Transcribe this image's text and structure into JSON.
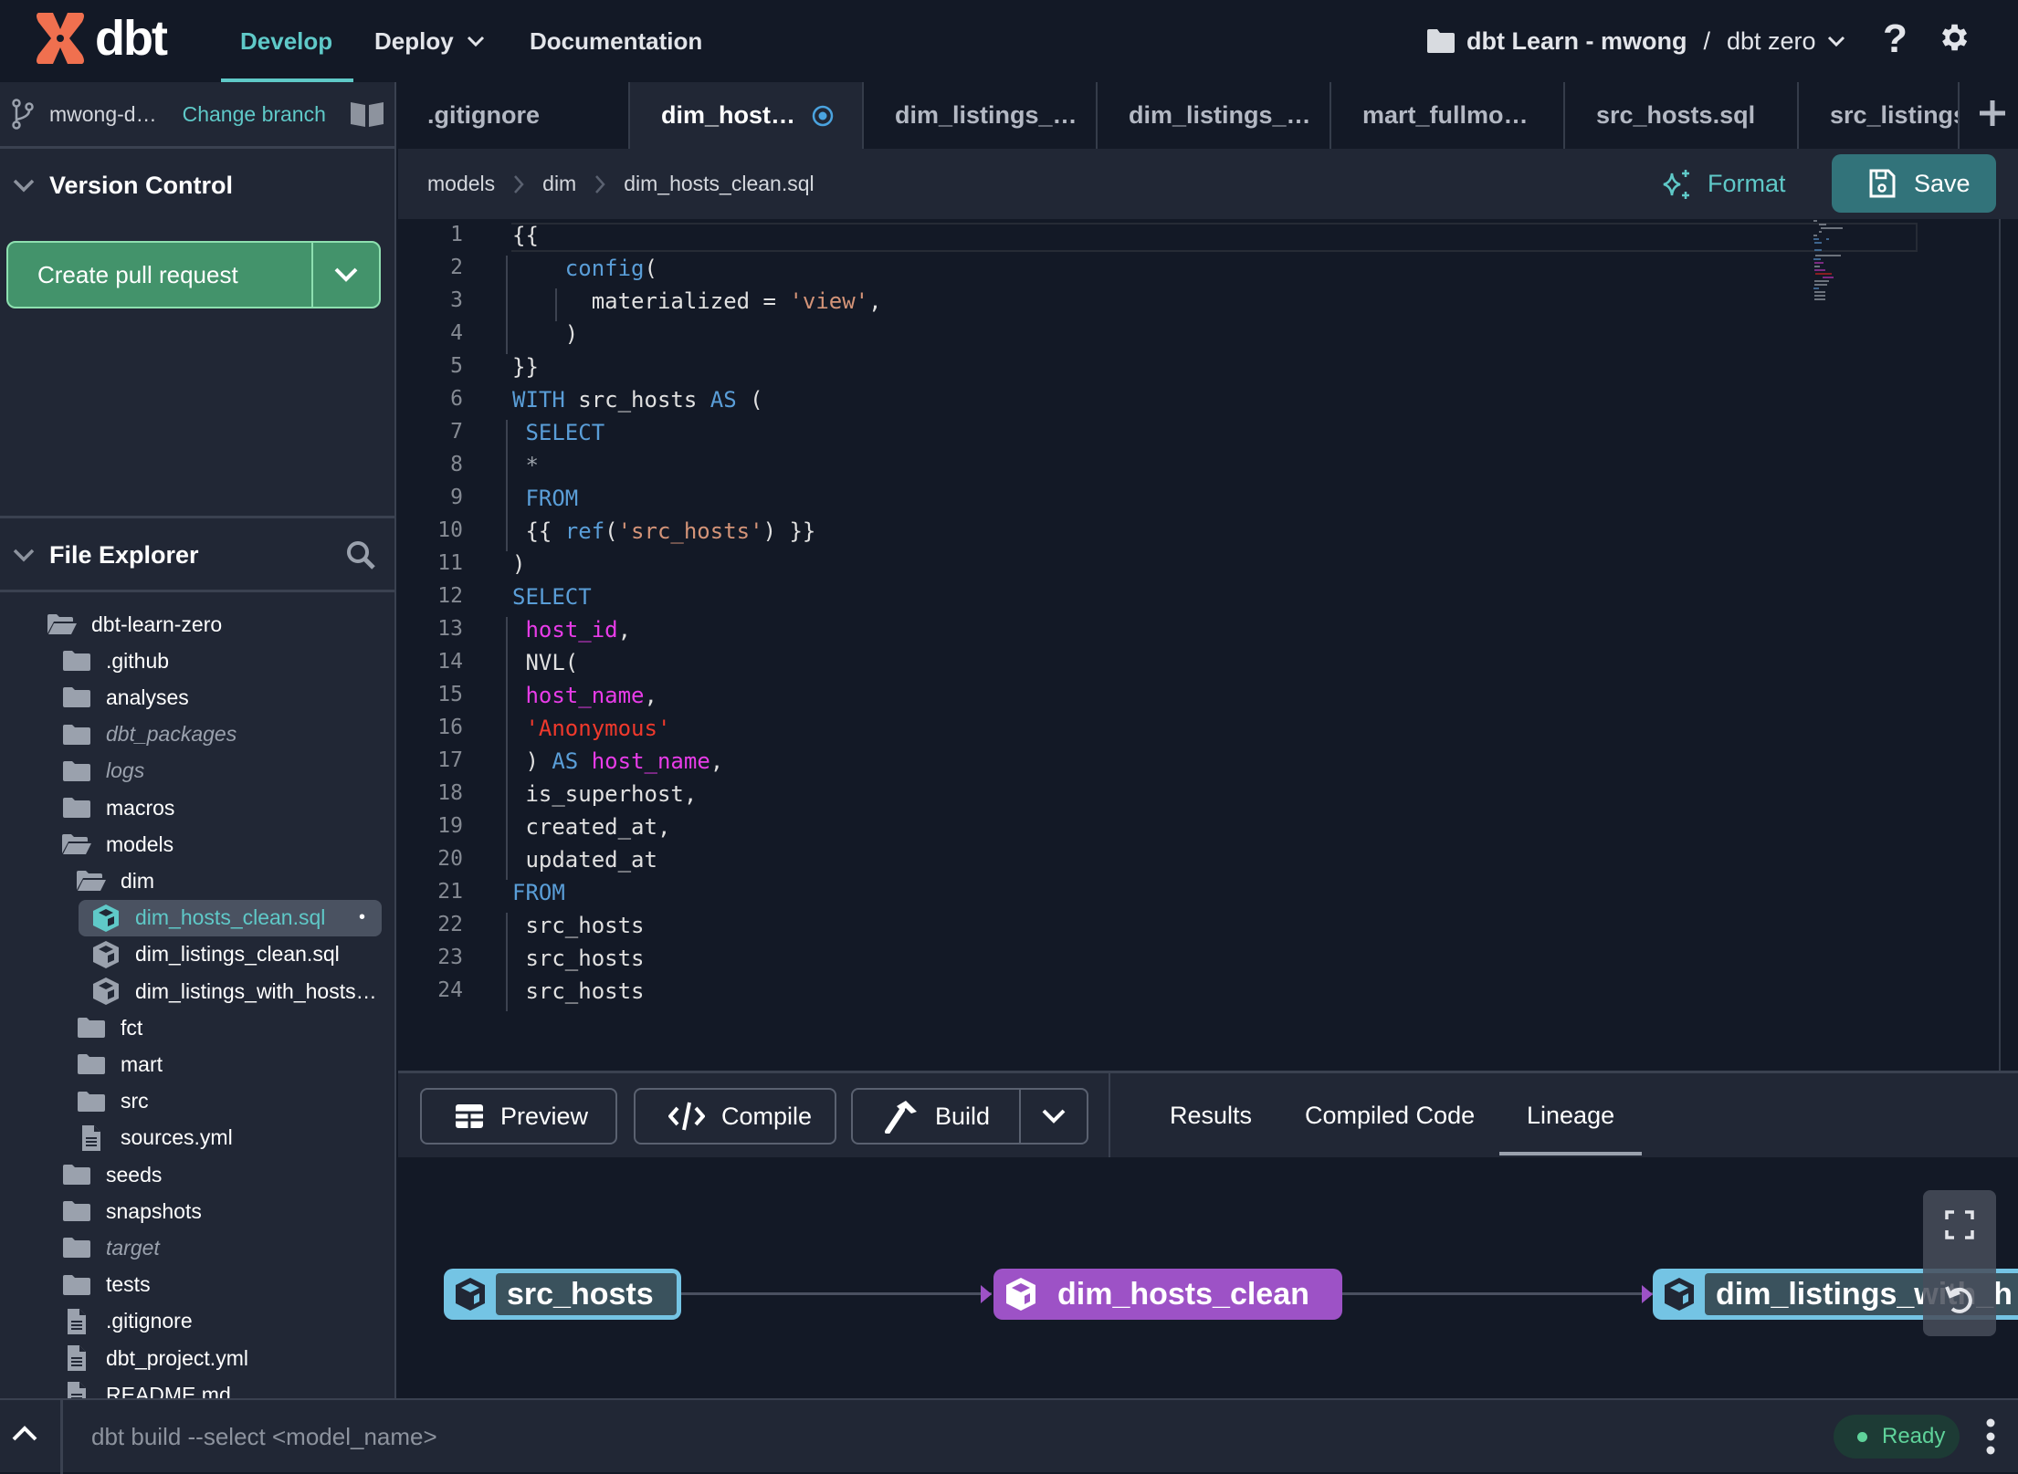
{
  "topbar": {
    "logo_text": "dbt",
    "nav": [
      "Develop",
      "Deploy",
      "Documentation"
    ],
    "account": "dbt Learn - mwong",
    "separator": "/",
    "project": "dbt zero"
  },
  "tabs": [
    ".gitignore",
    "dim_host…",
    "dim_listings_…",
    "dim_listings_…",
    "mart_fullmo…",
    "src_hosts.sql",
    "src_listings."
  ],
  "active_tab": 1,
  "sidebar": {
    "branch": "mwong-d…",
    "change_branch": "Change branch",
    "version_control": "Version Control",
    "create_pr": "Create pull request",
    "file_explorer": "File Explorer",
    "tree": [
      {
        "label": "dbt-learn-zero",
        "depth": 0,
        "icon": "folder-open"
      },
      {
        "label": ".github",
        "depth": 1,
        "icon": "folder"
      },
      {
        "label": "analyses",
        "depth": 1,
        "icon": "folder"
      },
      {
        "label": "dbt_packages",
        "depth": 1,
        "icon": "folder",
        "italic": true
      },
      {
        "label": "logs",
        "depth": 1,
        "icon": "folder",
        "italic": true
      },
      {
        "label": "macros",
        "depth": 1,
        "icon": "folder"
      },
      {
        "label": "models",
        "depth": 1,
        "icon": "folder-open"
      },
      {
        "label": "dim",
        "depth": 2,
        "icon": "folder-open"
      },
      {
        "label": "dim_hosts_clean.sql",
        "depth": 3,
        "icon": "model",
        "selected": true,
        "modified": "•"
      },
      {
        "label": "dim_listings_clean.sql",
        "depth": 3,
        "icon": "model"
      },
      {
        "label": "dim_listings_with_hosts…",
        "depth": 3,
        "icon": "model"
      },
      {
        "label": "fct",
        "depth": 2,
        "icon": "folder"
      },
      {
        "label": "mart",
        "depth": 2,
        "icon": "folder"
      },
      {
        "label": "src",
        "depth": 2,
        "icon": "folder"
      },
      {
        "label": "sources.yml",
        "depth": 2,
        "icon": "file"
      },
      {
        "label": "seeds",
        "depth": 1,
        "icon": "folder"
      },
      {
        "label": "snapshots",
        "depth": 1,
        "icon": "folder"
      },
      {
        "label": "target",
        "depth": 1,
        "icon": "folder",
        "italic": true
      },
      {
        "label": "tests",
        "depth": 1,
        "icon": "folder"
      },
      {
        "label": ".gitignore",
        "depth": 1,
        "icon": "file"
      },
      {
        "label": "dbt_project.yml",
        "depth": 1,
        "icon": "file"
      },
      {
        "label": "README.md",
        "depth": 1,
        "icon": "file"
      }
    ]
  },
  "breadcrumb": [
    "models",
    "dim",
    "dim_hosts_clean.sql"
  ],
  "editor_actions": {
    "format": "Format",
    "save": "Save"
  },
  "code": [
    [
      [
        "{{",
        ""
      ]
    ],
    [
      [
        "    ",
        ""
      ],
      [
        "config",
        "fn"
      ],
      [
        "(",
        ""
      ]
    ],
    [
      [
        "      materialized = ",
        ""
      ],
      [
        "'view'",
        "str"
      ],
      [
        ",",
        ""
      ]
    ],
    [
      [
        "    )",
        ""
      ]
    ],
    [
      [
        "}}",
        ""
      ]
    ],
    [
      [
        "WITH",
        "kw"
      ],
      [
        " src_hosts ",
        ""
      ],
      [
        "AS",
        "kw"
      ],
      [
        " (",
        ""
      ]
    ],
    [
      [
        " ",
        ""
      ],
      [
        "SELECT",
        "kw"
      ]
    ],
    [
      [
        " ",
        ""
      ],
      [
        "*",
        "op"
      ]
    ],
    [
      [
        " ",
        ""
      ],
      [
        "FROM",
        "kw"
      ]
    ],
    [
      [
        " {{ ",
        ""
      ],
      [
        "ref",
        "fn"
      ],
      [
        "(",
        ""
      ],
      [
        "'src_hosts'",
        "str"
      ],
      [
        ") }}",
        ""
      ]
    ],
    [
      [
        ")",
        ""
      ]
    ],
    [
      [
        "SELECT",
        "kw"
      ]
    ],
    [
      [
        " ",
        ""
      ],
      [
        "host_id",
        "col"
      ],
      [
        ",",
        ""
      ]
    ],
    [
      [
        " NVL(",
        ""
      ]
    ],
    [
      [
        " ",
        ""
      ],
      [
        "host_name",
        "col"
      ],
      [
        ",",
        ""
      ]
    ],
    [
      [
        " ",
        ""
      ],
      [
        "'Anonymous'",
        "red"
      ]
    ],
    [
      [
        " ) ",
        ""
      ],
      [
        "AS",
        "kw"
      ],
      [
        " ",
        ""
      ],
      [
        "host_name",
        "col"
      ],
      [
        ",",
        ""
      ]
    ],
    [
      [
        " is_superhost,",
        ""
      ]
    ],
    [
      [
        " created_at,",
        ""
      ]
    ],
    [
      [
        " updated_at",
        ""
      ]
    ],
    [
      [
        "FROM",
        "kw"
      ]
    ],
    [
      [
        " src_hosts",
        ""
      ]
    ],
    [
      [
        " src_hosts",
        ""
      ]
    ],
    [
      [
        " src_hosts",
        ""
      ]
    ]
  ],
  "bottom": {
    "preview": "Preview",
    "compile": "Compile",
    "build": "Build",
    "result_tabs": [
      "Results",
      "Compiled Code",
      "Lineage"
    ],
    "active_result_tab": 2
  },
  "lineage": {
    "nodes": [
      {
        "label": "src_hosts",
        "kind": "upstream"
      },
      {
        "label": "dim_hosts_clean",
        "kind": "current"
      },
      {
        "label": "dim_listings_with_h",
        "kind": "downstream"
      }
    ]
  },
  "statusbar": {
    "command_placeholder": "dbt build --select <model_name>",
    "status": "Ready"
  },
  "colors": {
    "accent": "#5fc9c8",
    "pr_green": "#43936b",
    "node_blue": "#74c4e4",
    "node_purple": "#9d52c6",
    "ready_green": "#5fd29a"
  }
}
